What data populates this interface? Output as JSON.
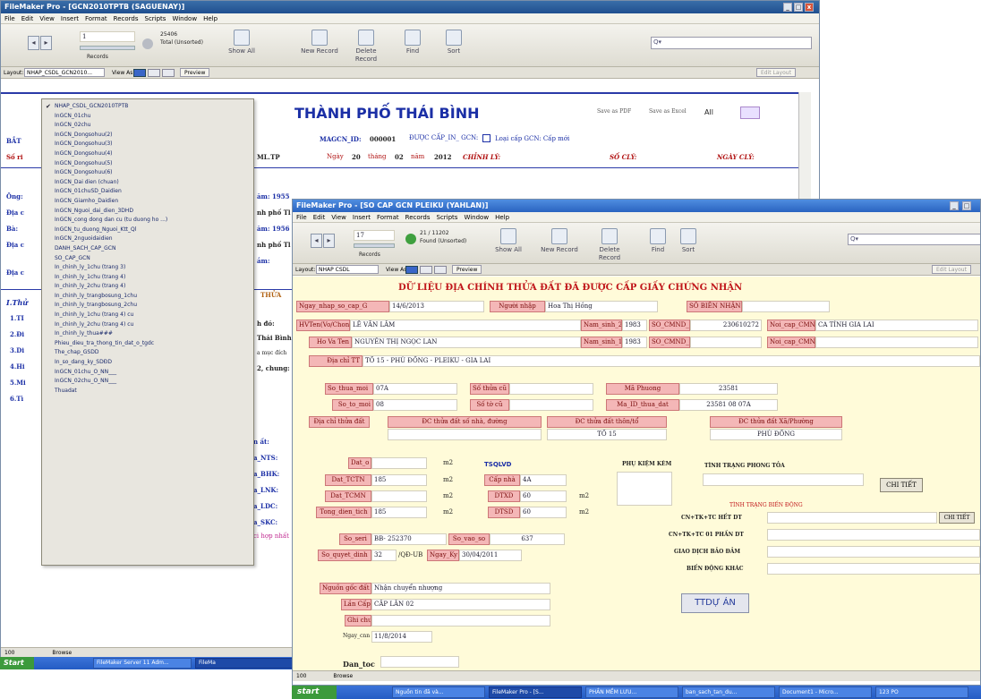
{
  "back_window": {
    "title": "FileMaker Pro - [GCN2010TPTB (SAGUENAY)]",
    "menus": [
      "File",
      "Edit",
      "View",
      "Insert",
      "Format",
      "Records",
      "Scripts",
      "Window",
      "Help"
    ],
    "toolbar": {
      "record_no": "1",
      "total": "25406",
      "total_label": "Total (Unsorted)",
      "records_label": "Records",
      "show_all": "Show All",
      "new_record": "New Record",
      "delete_record": "Delete Record",
      "find": "Find",
      "sort": "Sort"
    },
    "layoutbar": {
      "layout_label": "Layout:",
      "layout_value": "NHAP_CSDL_GCN2010...",
      "view_as": "View As:",
      "preview": "Preview",
      "edit_layout": "Edit Layout"
    },
    "header_title": "THÀNH PHỐ THÁI BÌNH",
    "save_pdf": "Save as PDF",
    "save_excel": "Save as Excel",
    "all_label": "All",
    "row2": {
      "maid_label": "MAGCN_ID:",
      "maid_value": "000001",
      "cap_in": "ĐƯỢC CẤP_IN_ GCN:",
      "loai_cap": "Loại cấp GCN: Cấp mới",
      "ngay": "Ngày",
      "day": "20",
      "thang": "tháng",
      "month": "02",
      "nam": "năm",
      "year": "2012",
      "chinh_ly": "CHỈNH LÝ:",
      "so_cly": "SỐ CLÝ:",
      "ngay_cly": "NGÀY CLÝ:",
      "ml_tp": "ML.TP",
      "bat": "BẮT",
      "sori": "Số ri"
    },
    "left_labels": [
      "Ông:",
      "Địa c",
      "Bà:",
      "Địa c",
      "Địa c"
    ],
    "mid_labels": [
      "ăm: 1955",
      "nh phố Tl",
      "ăm: 1956",
      "nh phố Tl",
      "ắm:"
    ],
    "section_label": "I.Thử",
    "list_codes": [
      "1.TI",
      "2.Đi",
      "3.Di",
      "4.Hi",
      "5.Mi",
      "6.Tì"
    ],
    "right_labels": [
      "THỬA",
      "h đó:",
      "Thái Bình",
      "a mục đích",
      "2, chung:",
      "n ất:",
      "a_NTS:",
      "a_BHK:",
      "a_LNK:",
      "a_LDC:",
      "a_SKC:",
      "ci hợp nhất"
    ],
    "bottom_status": "100",
    "bottom_mode": "Browse",
    "dropdown_items": [
      "NHAP_CSDL_GCN2010TPTB",
      "InGCN_01chu",
      "InGCN_02chu",
      "InGCN_Dongsohuu(2)",
      "InGCN_Dongsohuu(3)",
      "InGCN_Dongsohuu(4)",
      "InGCN_Dongsohuu(5)",
      "InGCN_Dongsohuu(6)",
      "InGCN_Dai dien (chuan)",
      "InGCN_01chuSD_Daidien",
      "InGCN_Giamho_Daidien",
      "InGCN_Nguoi_dai_dien_3DHD",
      "InGCN_cong dong dan cu (tu duong ho ...)",
      "InGCN_tu_duong_Nguoi_Ktt_Ql",
      "InGCN_2nguoidaidien",
      "DANH_SACH_CAP_GCN",
      "SO_CAP_GCN",
      "In_chinh_ly_1chu (trang 3)",
      "In_chinh_ly_1chu (trang 4)",
      "In_chinh_ly_2chu (trang 4)",
      "In_chinh_ly_trangbosung_1chu",
      "In_chinh_ly_trangbosung_2chu",
      "In_chinh_ly_1chu (trang 4) cu",
      "In_chinh_ly_2chu (trang 4) cu",
      "In_chinh_ly_thua###",
      "Phieu_dieu_tra_thong_tin_dat_o_tgdc",
      "The_chap_GSDD",
      "In_so_dang_ky_SDĐD",
      "InGCN_01chu_O_NN___",
      "InGCN_02chu_O_NN___",
      "Thuadat"
    ]
  },
  "front_window": {
    "title": "FileMaker Pro - [SO CAP GCN PLEIKU (YAHLAN)]",
    "menus": [
      "File",
      "Edit",
      "View",
      "Insert",
      "Format",
      "Records",
      "Scripts",
      "Window",
      "Help"
    ],
    "toolbar": {
      "record_no": "17",
      "found": "21 / 11202",
      "found_label": "Found (Unsorted)",
      "records_label": "Records",
      "show_all": "Show All",
      "new_record": "New Record",
      "delete_record": "Delete Record",
      "find": "Find",
      "sort": "Sort"
    },
    "layoutbar": {
      "layout_label": "Layout:",
      "layout_value": "NHAP CSDL",
      "view_as": "View As:",
      "preview": "Preview",
      "edit_layout": "Edit Layout"
    },
    "form_title": "DỮ LIỆU ĐỊA CHÍNH THỬA ĐẤT ĐÃ ĐƯỢC CẤP GIẤY CHỨNG NHẬN",
    "fields": {
      "ngay_nhap_label": "Ngay_nhap_so_cap_G",
      "ngay_nhap": "14/6/2013",
      "nguoi_nhap_label": "Người nhập",
      "nguoi_nhap": "Hoa Thị Hồng",
      "so_bien_nhan_label": "SỐ BIÊN NHẬN",
      "ho_ten1_label": "HVTen(Vo/Chong)",
      "ho_ten1": "LÊ VĂN LÂM",
      "nam_sinh1_label": "Nam_sinh_2",
      "nam_sinh1": "1983",
      "cmnd1_label": "SO_CMND_2",
      "cmnd1": "230610272",
      "noi_cap1_label": "Noi_cap_CMND_2",
      "noi_cap1": "CA TỈNH GIA LAI",
      "ho_ten2_label": "Ho Va Ten",
      "ho_ten2": "NGUYỄN THỊ NGỌC LAN",
      "nam_sinh2_label": "Nam_sinh_1",
      "nam_sinh2": "1983",
      "cmnd2_label": "SO_CMND_1",
      "noi_cap2_label": "Noi_cap_CMND_1",
      "dia_chi_label": "Địa chỉ TT",
      "dia_chi": "TỔ 15 - PHÙ ĐỔNG - PLEIKU - GIA LAI",
      "so_thua_label": "So_thua_moi",
      "so_thua": "07A",
      "so_thua_cu_label": "Số thửa cũ",
      "ma_phuong_label": "Mã Phuong",
      "ma_phuong": "23581",
      "so_to_label": "So_to_moi",
      "so_to": "08",
      "so_to_cu_label": "Số tờ cũ",
      "ma_id_label": "Ma_ID_thua_dat",
      "ma_id": "23581 08 07A",
      "dc_chi_tiet_label": "Địa chỉ thửa đất",
      "dc_so_nha_label": "ĐC thửa đất số nhà, đường",
      "dc_thon_label": "ĐC thửa đất thôn/tổ",
      "dc_thon": "TỔ 15",
      "dc_xa_label": "ĐC thửa đất Xã/Phường",
      "dc_xa": "PHÙ ĐỔNG",
      "dat_o_label": "Dat_o",
      "dat_o_unit": "m2",
      "tsqlvd": "TSQLVD",
      "phu_kem": "PHỤ KIỆM KÈM",
      "tinh_trang_pt": "TÌNH TRẠNG PHONG TỎA",
      "dat_tctn_label": "Dat_TCTN",
      "dat_tctn": "185",
      "cap_nha_label": "Cấp nhà",
      "cap_nha": "4A",
      "dat_tcmn_label": "Dat_TCMN",
      "dtxd_label": "DTXD",
      "dtxd": "60",
      "tong_dt_label": "Tong_dien_tich",
      "tong_dt": "185",
      "dtsd_label": "DTSD",
      "dtsd": "60",
      "chi_tiet": "CHI TIẾT",
      "tinh_trang_bd": "TÌNH TRẠNG BIẾN ĐỘNG",
      "cn_het": "CN+TK+TC HẾT DT",
      "cn_mot_phan": "CN+TK+TC 01 PHẦN DT",
      "giao_dich": "GIAO DỊCH BẢO ĐẢM",
      "bien_dong_khac": "BIẾN ĐỘNG KHÁC",
      "so_serial_label": "So_seri",
      "so_serial": "BB- 252370",
      "so_vao_so_label": "So_vao_so",
      "so_vao_so": "637",
      "so_qd_label": "So_quyet_dinh",
      "so_qd": "32",
      "qd_ub": "/QĐ-UB",
      "ngay_ky_label": "Ngay_Ky",
      "ngay_ky": "30/04/2011",
      "nguon_goc_label": "Nguồn gốc đất",
      "nguon_goc": "Nhận chuyển nhượng",
      "lan_cap_label": "Lần Cấp",
      "lan_cap": "CẤP LẦN 02",
      "ghi_chu_label": "Ghi chu",
      "ngay_cn_label": "Ngay_cnn",
      "ngay_cn": "11/8/2014",
      "ttdu_an": "TTDỰ ÁN",
      "dan_toc_label": "Dan_toc"
    },
    "bottom_status": "100",
    "bottom_mode": "Browse"
  },
  "taskbar_back": {
    "start": "Start",
    "items": [
      "FileMaker Server 11 Adm...",
      "FileMa"
    ]
  },
  "taskbar_front": {
    "start": "start",
    "items": [
      "Nguồn tin đã và...",
      "FileMaker Pro - [S...",
      "PHẦN MỀM LƯU...",
      "ban_sach_tan_du...",
      "Document1 - Micro...",
      "123 PO"
    ]
  }
}
